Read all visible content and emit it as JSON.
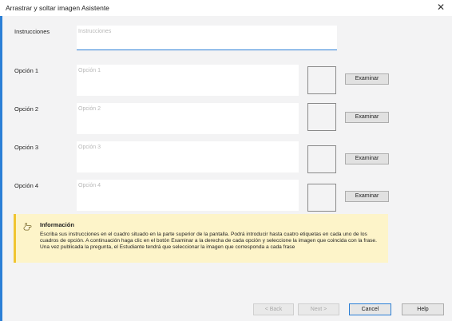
{
  "window": {
    "title": "Arrastrar y soltar imagen Asistente",
    "close_glyph": "✕"
  },
  "instructions": {
    "label": "Instrucciones",
    "placeholder": "Instrucciones"
  },
  "options": [
    {
      "label": "Opción 1",
      "placeholder": "Opción 1",
      "browse_label": "Examinar"
    },
    {
      "label": "Opción 2",
      "placeholder": "Opción 2",
      "browse_label": "Examinar"
    },
    {
      "label": "Opción 3",
      "placeholder": "Opción 3",
      "browse_label": "Examinar"
    },
    {
      "label": "Opción 4",
      "placeholder": "Opción 4",
      "browse_label": "Examinar"
    }
  ],
  "info": {
    "title": "Información",
    "icon": "pointing-hand-icon",
    "text": "Escriba sus instrucciones en el cuadro situado en la parte superior de la pantalla. Podrá introducir hasta cuatro etiquetas en cada uno de los cuadros de opción. A continuación haga clic en el botón Examinar a la derecha de cada opción y seleccione la imagen que coincida con la frase. Una vez publicada la pregunta, el Estudiante tendrá que seleccionar la imagen que corresponda a cada frase",
    "background": "#fdf4c9",
    "accent": "#f0c531"
  },
  "footer": {
    "back_label": "< Back",
    "next_label": "Next >",
    "cancel_label": "Cancel",
    "help_label": "Help"
  },
  "colors": {
    "accent": "#2b7fd6",
    "window_bg": "#f3f3f4"
  }
}
